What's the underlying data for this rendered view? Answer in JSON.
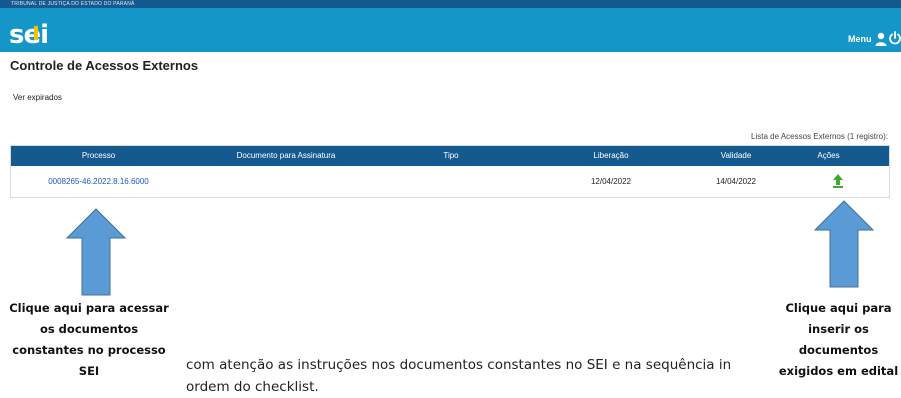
{
  "topbar": {
    "org_name": "TRIBUNAL DE JUSTIÇA DO ESTADO DO PARANÁ"
  },
  "header": {
    "logo": "sei",
    "menu_label": "Menu",
    "user_icon": "user-icon",
    "power_icon": "power-icon",
    "accent": "#1596c9",
    "dark_accent": "#155a8f"
  },
  "page": {
    "title": "Controle de Acessos Externos",
    "ver_expirados": "Ver expirados"
  },
  "table": {
    "caption": "Lista de Acessos Externos (1 registro):",
    "headers": [
      "Processo",
      "Documento para Assinatura",
      "Tipo",
      "Liberação",
      "Validade",
      "Ações"
    ],
    "rows": [
      {
        "processo": "0008265-46.2022.8.16.6000",
        "documento": "",
        "tipo": "",
        "liberacao": "12/04/2022",
        "validade": "14/04/2022",
        "acao_icon": "upload-icon"
      }
    ]
  },
  "annotations": {
    "left": [
      "Clique aqui para acessar",
      "os documentos",
      "constantes no processo",
      "SEI"
    ],
    "right": [
      "Clique aqui para",
      "inserir os",
      "documentos",
      "exigidos em edital"
    ],
    "arrow_color": "#5b9bd5"
  },
  "body_text": [
    "com atenção as instruções nos documentos constantes no SEI e na sequência in",
    "ordem do checklist."
  ]
}
